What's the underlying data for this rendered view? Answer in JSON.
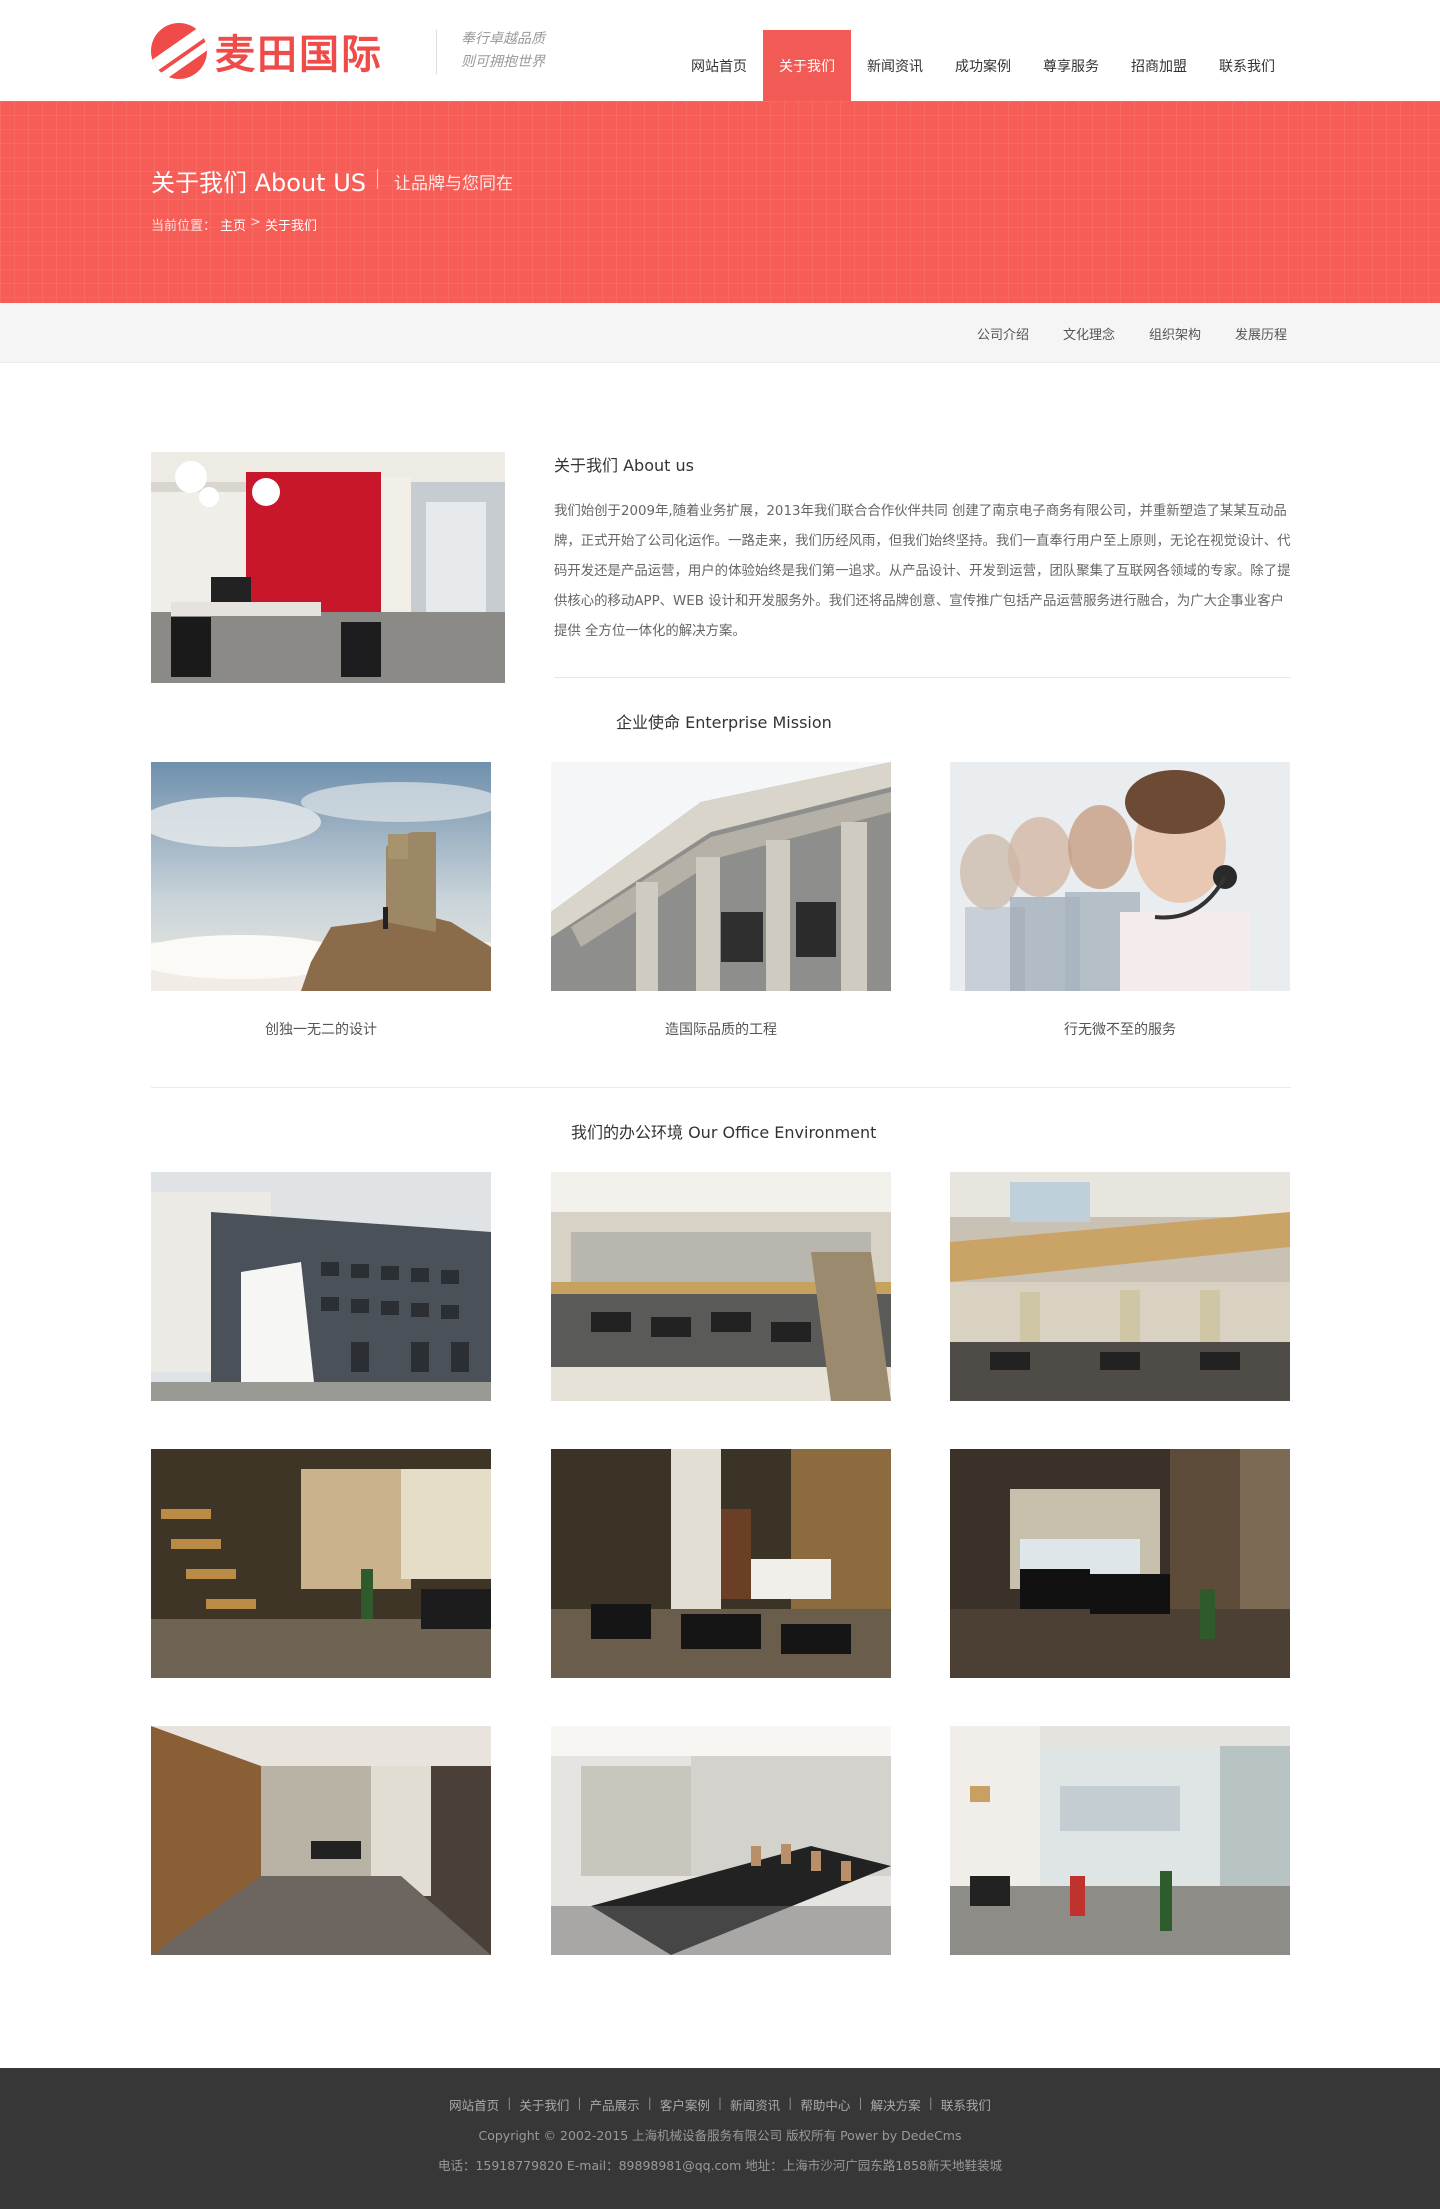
{
  "header": {
    "logo_text": "麦田国际",
    "slogan_line1": "奉行卓越品质",
    "slogan_line2": "则可拥抱世界",
    "nav": [
      {
        "label": "网站首页",
        "active": false
      },
      {
        "label": "关于我们",
        "active": true
      },
      {
        "label": "新闻资讯",
        "active": false
      },
      {
        "label": "成功案例",
        "active": false
      },
      {
        "label": "尊享服务",
        "active": false
      },
      {
        "label": "招商加盟",
        "active": false
      },
      {
        "label": "联系我们",
        "active": false
      }
    ]
  },
  "banner": {
    "title": "关于我们 About US",
    "subtitle": "让品牌与您同在",
    "breadcrumb_prefix": "当前位置：",
    "breadcrumb_home": "主页",
    "breadcrumb_sep": ">",
    "breadcrumb_current": "关于我们"
  },
  "subnav": [
    "公司介绍",
    "文化理念",
    "组织架构",
    "发展历程"
  ],
  "about": {
    "title": "关于我们 About us",
    "text": "我们始创于2009年,随着业务扩展，2013年我们联合合作伙伴共同 创建了南京电子商务有限公司，并重新塑造了某某互动品牌，正式开始了公司化运作。一路走来，我们历经风雨，但我们始终坚持。我们一直奉行用户至上原则，无论在视觉设计、代码开发还是产品运营，用户的体验始终是我们第一追求。从产品设计、开发到运营，团队聚集了互联网各领域的专家。除了提供核心的移动APP、WEB 设计和开发服务外。我们还将品牌创意、宣传推广包括产品运营服务进行融合，为广大企事业客户提供 全方位一体化的解决方案。"
  },
  "mission": {
    "title": "企业使命 Enterprise Mission",
    "items": [
      {
        "caption": "创独一无二的设计",
        "image": "sky-number-one-photo"
      },
      {
        "caption": "造国际品质的工程",
        "image": "classical-columns-photo"
      },
      {
        "caption": "行无微不至的服务",
        "image": "customer-service-photo"
      }
    ]
  },
  "office": {
    "title": "我们的办公环境 Our Office Environment",
    "photos": [
      "office-building-exterior",
      "open-office-floor",
      "office-mezzanine",
      "lobby-staircase",
      "reception-lounge",
      "leather-sofa-lounge",
      "wood-corridor",
      "conference-room",
      "glass-partition-office"
    ]
  },
  "footer": {
    "links": [
      "网站首页",
      "关于我们",
      "产品展示",
      "客户案例",
      "新闻资讯",
      "帮助中心",
      "解决方案",
      "联系我们"
    ],
    "link_sep": "|",
    "copyright": "Copyright © 2002-2015 上海机械设备服务有限公司 版权所有 Power by DedeCms",
    "contact": "电话：15918779820 E-mail：89898981@qq.com 地址：上海市沙河广园东路1858新天地鞋装城"
  },
  "colors": {
    "brand": "#ef4b49",
    "banner": "#f75d57",
    "footer": "#373737"
  }
}
